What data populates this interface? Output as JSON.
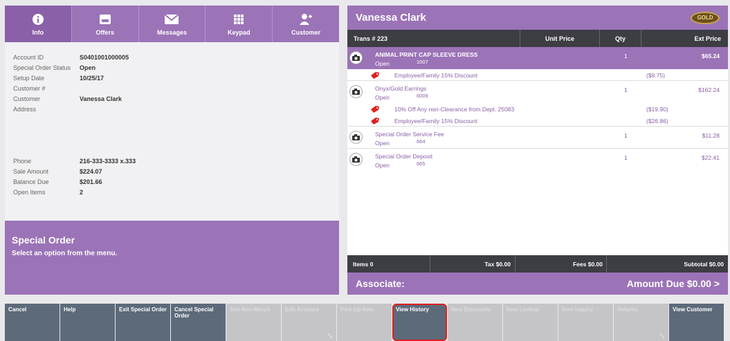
{
  "tabs": [
    {
      "label": "Info",
      "icon": "info-icon"
    },
    {
      "label": "Offers",
      "icon": "offers-icon"
    },
    {
      "label": "Messages",
      "icon": "envelope-icon"
    },
    {
      "label": "Keypad",
      "icon": "keypad-icon"
    },
    {
      "label": "Customer",
      "icon": "add-customer-icon"
    }
  ],
  "account": {
    "account_id_label": "Account ID",
    "account_id": "S0401001000005",
    "status_label": "Special Order Status",
    "status": "Open",
    "setup_label": "Setup Date",
    "setup": "10/25/17",
    "customer_no_label": "Customer #",
    "customer_label": "Customer",
    "customer": "Vanessa Clark",
    "address_label": "Address",
    "phone_label": "Phone",
    "phone": "216-333-3333 x.333",
    "sale_label": "Sale Amount",
    "sale": "$224.07",
    "balance_label": "Balance Due",
    "balance": "$201.66",
    "open_items_label": "Open Items",
    "open_items": "2"
  },
  "special_order": {
    "title": "Special Order",
    "subtitle": "Select an option from the menu."
  },
  "customer_header": {
    "name": "Vanessa Clark",
    "badge": "GOLD"
  },
  "columns": {
    "trans": "Trans # 223",
    "unit": "Unit Price",
    "qty": "Qty",
    "ext": "Ext Price"
  },
  "items": [
    {
      "name": "ANIMAL PRINT CAP SLEEVE DRESS",
      "status": "Open",
      "sku": "1007",
      "qty": "1",
      "ext": "$65.24",
      "discounts": [
        {
          "name": "Employee/Family 15% Discount",
          "amount": "($9.75)"
        }
      ]
    },
    {
      "name": "Onyx/Gold Earrings",
      "status": "Open",
      "sku": "6009",
      "qty": "1",
      "ext": "$162.24",
      "discounts": [
        {
          "name": "10% Off Any non-Clearance from Dept. 25083",
          "amount": "($19.90)"
        },
        {
          "name": "Employee/Family 15% Discount",
          "amount": "($26.86)"
        }
      ]
    },
    {
      "name": "Special Order Service Fee",
      "status": "Open",
      "sku": "664",
      "qty": "1",
      "ext": "$11.28",
      "discounts": []
    },
    {
      "name": "Special Order Deposit",
      "status": "Open",
      "sku": "665",
      "qty": "1",
      "ext": "$22.41",
      "discounts": []
    }
  ],
  "totals": {
    "items": "Items 0",
    "tax": "Tax $0.00",
    "fees": "Fees $0.00",
    "subtotal": "Subtotal $0.00"
  },
  "associate": {
    "label": "Associate:",
    "amount_due": "Amount Due  $0.00  >"
  },
  "bottom_buttons": [
    {
      "label": "Cancel",
      "enabled": true
    },
    {
      "label": "Help",
      "enabled": true
    },
    {
      "label": "Exit Special Order",
      "enabled": true
    },
    {
      "label": "Cancel Special Order",
      "enabled": true
    },
    {
      "label": "Sell Non-Merch",
      "enabled": false
    },
    {
      "label": "Edit Account",
      "enabled": false
    },
    {
      "label": "Pick Up Item",
      "enabled": false
    },
    {
      "label": "View History",
      "enabled": true,
      "highlight": true
    },
    {
      "label": "Item Discounts",
      "enabled": false
    },
    {
      "label": "Item Lookup",
      "enabled": false
    },
    {
      "label": "Item Inquiry",
      "enabled": false
    },
    {
      "label": "Returns",
      "enabled": false
    },
    {
      "label": "View Customer",
      "enabled": true
    }
  ],
  "colors": {
    "purple": "#9b73b7",
    "dark": "#3d3d44",
    "slate": "#5d6a7a",
    "highlight": "#e1201f"
  }
}
